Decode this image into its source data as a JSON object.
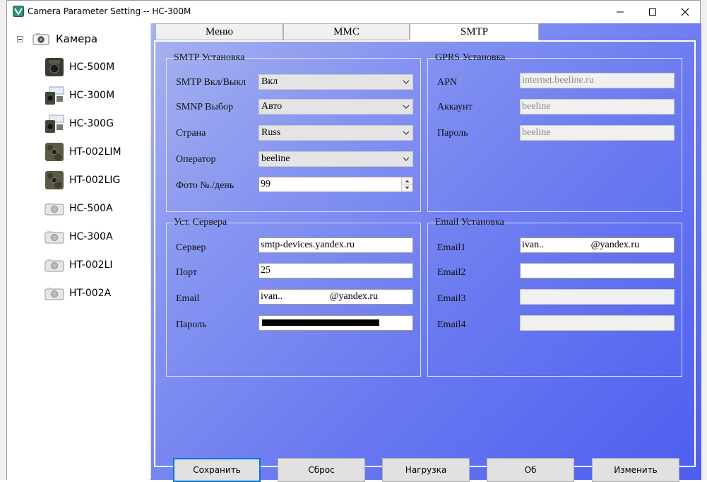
{
  "window": {
    "title": "Camera Parameter Setting -- HC-300M",
    "controls": [
      "minimize",
      "maximize",
      "close"
    ]
  },
  "tree": {
    "root_label": "Камера",
    "items": [
      {
        "label": "HC-500M",
        "icon": "camera-trap-dark-icon"
      },
      {
        "label": "HC-300M",
        "icon": "camera-trap-kit-icon"
      },
      {
        "label": "HC-300G",
        "icon": "camera-trap-kit-icon"
      },
      {
        "label": "HT-002LIM",
        "icon": "camera-trap-camo-icon"
      },
      {
        "label": "HT-002LIG",
        "icon": "camera-trap-camo-icon"
      },
      {
        "label": "HC-500A",
        "icon": "camera-gray-icon"
      },
      {
        "label": "HC-300A",
        "icon": "camera-gray-icon"
      },
      {
        "label": "HT-002LI",
        "icon": "camera-gray-icon"
      },
      {
        "label": "HT-002A",
        "icon": "camera-gray-icon"
      }
    ]
  },
  "tabs": [
    {
      "label": "Меню",
      "active": false
    },
    {
      "label": "MMC",
      "active": false
    },
    {
      "label": "SMTP",
      "active": true
    }
  ],
  "smtp": {
    "title": "SMTP Установка",
    "enable": {
      "label": "SMTP Вкл/Выкл",
      "value": "Вкл"
    },
    "select": {
      "label": "SMNP Выбор",
      "value": "Авто"
    },
    "country": {
      "label": "Страна",
      "value": "Russ"
    },
    "operator": {
      "label": "Оператор",
      "value": "beeline"
    },
    "photos": {
      "label": "Фото №./день",
      "value": "99"
    }
  },
  "gprs": {
    "title": "GPRS Установка",
    "apn": {
      "label": "APN",
      "value": "internet.beeline.ru"
    },
    "account": {
      "label": "Аккаунт",
      "value": "beeline"
    },
    "password": {
      "label": "Пароль",
      "value": "beeline"
    }
  },
  "server": {
    "title": "Уст. Сервера",
    "server": {
      "label": "Сервер",
      "value": "smtp-devices.yandex.ru"
    },
    "port": {
      "label": "Порт",
      "value": "25"
    },
    "email": {
      "label": "Email",
      "value": "ivan..                   @yandex.ru"
    },
    "password": {
      "label": "Пароль",
      "value": ""
    }
  },
  "email": {
    "title": "Email Установка",
    "email1": {
      "label": "Email1",
      "value": "ivan..                   @yandex.ru"
    },
    "email2": {
      "label": "Email2",
      "value": ""
    },
    "email3": {
      "label": "Email3",
      "value": ""
    },
    "email4": {
      "label": "Email4",
      "value": ""
    }
  },
  "buttons": {
    "save": "Сохранить",
    "reset": "Сброс",
    "load": "Нагрузка",
    "about": "Об",
    "modify": "Изменить"
  },
  "colors": {
    "panel_gradient_start": "#a7b2ef",
    "panel_gradient_end": "#4d5ef0",
    "default_button_border": "#0078d7"
  }
}
